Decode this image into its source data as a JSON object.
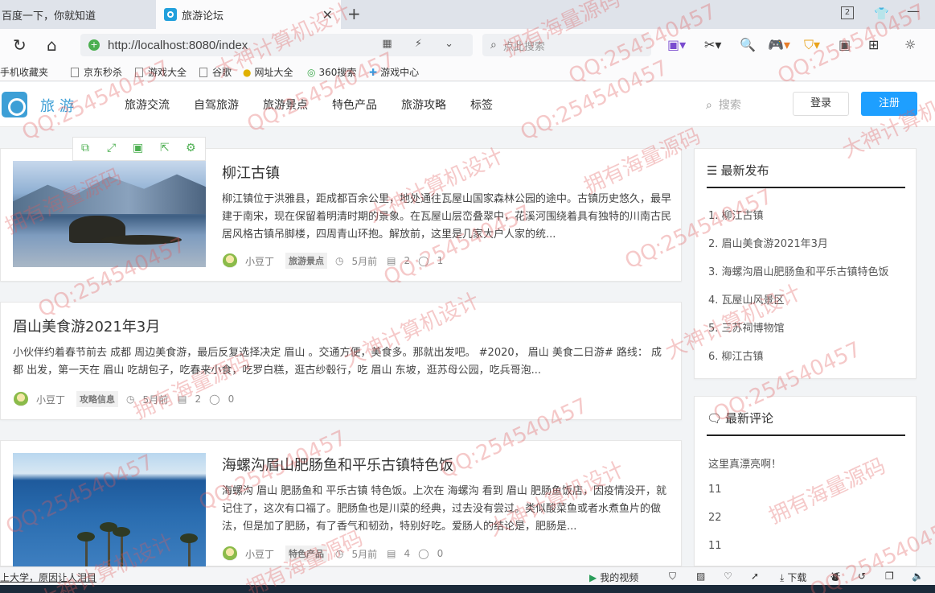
{
  "browser": {
    "tabs": [
      {
        "label": "百度一下，你就知道"
      },
      {
        "label": "旅游论坛"
      }
    ],
    "url": "http://localhost:8080/index",
    "search_placeholder": "点此搜索",
    "tab_count": "2",
    "bookmarks": [
      "手机收藏夹",
      "京东秒杀",
      "游戏大全",
      "谷歌",
      "网址大全",
      "360搜索",
      "游戏中心"
    ]
  },
  "site": {
    "logo": "旅游",
    "menu": [
      "旅游交流",
      "自驾旅游",
      "旅游景点",
      "特色产品",
      "旅游攻略",
      "标签"
    ],
    "search_placeholder": "搜索",
    "login": "登录",
    "register": "注册"
  },
  "posts": [
    {
      "title": "柳江古镇",
      "excerpt": "柳江镇位于洪雅县，距成都百余公里，地处通往瓦屋山国家森林公园的途中。古镇历史悠久，最早建于南宋，现在保留着明清时期的景象。在瓦屋山层峦叠翠中，花溪河围绕着具有独特的川南古民居风格古镇吊脚楼，四周青山环抱。解放前，这里是几家大户人家的统...",
      "author": "小豆丁",
      "category": "旅游景点",
      "time": "5月前",
      "views": "2",
      "comments": "1"
    },
    {
      "title": "眉山美食游2021年3月",
      "excerpt": "小伙伴约着春节前去 成都 周边美食游，最后反复选择决定 眉山 。交通方便，美食多。那就出发吧。 #2020， 眉山 美食二日游# 路线： 成都 出发，第一天在 眉山 吃胡包子，吃春来小食，吃罗白糕，逛古纱毂行，吃 眉山 东坡，逛苏母公园，吃兵哥泡...",
      "author": "小豆丁",
      "category": "攻略信息",
      "time": "5月前",
      "views": "2",
      "comments": "0"
    },
    {
      "title": "海螺沟眉山肥肠鱼和平乐古镇特色饭",
      "excerpt": "海螺沟 眉山 肥肠鱼和 平乐古镇 特色饭。上次在 海螺沟 看到 眉山 肥肠鱼饭店，因疫情没开，就记住了，这次有口福了。肥肠鱼也是川菜的经典，过去没有尝过。类似酸菜鱼或者水煮鱼片的做法，但是加了肥肠，有了香气和韧劲，特别好吃。爱肠人的结论是，肥肠是...",
      "author": "小豆丁",
      "category": "特色产品",
      "time": "5月前",
      "views": "4",
      "comments": "0"
    }
  ],
  "sidebar": {
    "latest": {
      "title": "最新发布",
      "items": [
        "1. 柳江古镇",
        "2. 眉山美食游2021年3月",
        "3. 海螺沟眉山肥肠鱼和平乐古镇特色饭",
        "4. 瓦屋山风景区",
        "5. 三苏祠博物馆",
        "6. 柳江古镇"
      ]
    },
    "comments": {
      "title": "最新评论",
      "items": [
        "这里真漂亮啊！",
        "11",
        "22",
        "11"
      ]
    }
  },
  "statusbar": {
    "left": "上大学，原因让人泪目",
    "video": "我的视频",
    "download": "下载"
  },
  "watermark": {
    "qq": "QQ:254540457",
    "own": "拥有海量源码",
    "design": "大神计算机设计"
  }
}
